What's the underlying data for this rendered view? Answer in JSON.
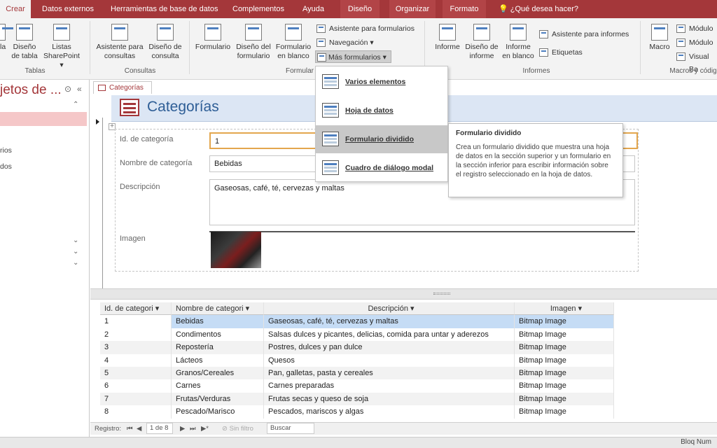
{
  "tabs": [
    "Crear",
    "Datos externos",
    "Herramientas de base de datos",
    "Complementos",
    "Ayuda",
    "Diseño",
    "Organizar",
    "Formato"
  ],
  "tell_me": "¿Qué desea hacer?",
  "ribbon": {
    "tablas": {
      "group": "Tablas",
      "btn_a": "a",
      "btn_a2": "la",
      "diseno_tabla": [
        "Diseño",
        "de tabla"
      ],
      "listas": [
        "Listas",
        "SharePoint ▾"
      ]
    },
    "consultas": {
      "group": "Consultas",
      "asistente": [
        "Asistente para",
        "consultas"
      ],
      "diseno": [
        "Diseño de",
        "consulta"
      ]
    },
    "formularios": {
      "group": "Formularios",
      "formulario": "Formulario",
      "diseno": [
        "Diseño del",
        "formulario"
      ],
      "blanco": [
        "Formulario",
        "en blanco"
      ],
      "asistente": "Asistente para formularios",
      "navegacion": "Navegación ▾",
      "mas": "Más formularios ▾"
    },
    "informes": {
      "group": "Informes",
      "informe": "Informe",
      "diseno": [
        "Diseño de",
        "informe"
      ],
      "blanco": [
        "Informe",
        "en blanco"
      ],
      "asistente": "Asistente para informes",
      "etiquetas": "Etiquetas"
    },
    "macros": {
      "group": "Macros y códig",
      "macro": "Macro",
      "modulo": "Módulo",
      "modulo_clase": "Módulo",
      "visual": "Visual Ba"
    }
  },
  "nav": {
    "title": "jetos de ...",
    "items": [
      "rios",
      "dos"
    ]
  },
  "doc": {
    "tab": "Categorías",
    "title": "Categorías",
    "fields": {
      "id_label": "Id. de categoría",
      "id_value": "1",
      "nombre_label": "Nombre de categoría",
      "nombre_value": "Bebidas",
      "desc_label": "Descripción",
      "desc_value": "Gaseosas, café, té, cervezas y maltas",
      "imagen_label": "Imagen"
    },
    "datasheet": {
      "headers": [
        "Id. de categori ▾",
        "Nombre de categori ▾",
        "Descripción ▾",
        "Imagen ▾"
      ],
      "rows": [
        [
          "1",
          "Bebidas",
          "Gaseosas, café, té, cervezas y maltas",
          "Bitmap Image"
        ],
        [
          "2",
          "Condimentos",
          "Salsas dulces y picantes, delicias, comida para untar y aderezos",
          "Bitmap Image"
        ],
        [
          "3",
          "Repostería",
          "Postres, dulces y pan dulce",
          "Bitmap Image"
        ],
        [
          "4",
          "Lácteos",
          "Quesos",
          "Bitmap Image"
        ],
        [
          "5",
          "Granos/Cereales",
          "Pan, galletas, pasta y cereales",
          "Bitmap Image"
        ],
        [
          "6",
          "Carnes",
          "Carnes preparadas",
          "Bitmap Image"
        ],
        [
          "7",
          "Frutas/Verduras",
          "Frutas secas y queso de soja",
          "Bitmap Image"
        ],
        [
          "8",
          "Pescado/Marisco",
          "Pescados, mariscos y algas",
          "Bitmap Image"
        ]
      ]
    },
    "record_nav": {
      "label": "Registro:",
      "first": "⏮",
      "prev": "◀",
      "pos": "1 de 8",
      "next": "▶",
      "last": "⏭",
      "new": "▶*",
      "filter": "Sin filtro",
      "search": "Buscar"
    }
  },
  "dropdown": {
    "items": [
      "Varios elementos",
      "Hoja de datos",
      "Formulario dividido",
      "Cuadro de diálogo modal"
    ],
    "highlighted": "Formulario dividido"
  },
  "tooltip": {
    "title": "Formulario dividido",
    "body": "Crea un formulario dividido que muestra una hoja de datos en la sección superior y un formulario en la sección inferior para escribir información sobre el registro seleccionado en la hoja de datos."
  },
  "status": {
    "bloq": "Bloq Num"
  },
  "colors": {
    "accent": "#a4373a",
    "header_blue": "#dce6f4",
    "title_blue": "#2e5e96",
    "selection": "#c5dcf5",
    "focus": "#e3a64d"
  }
}
